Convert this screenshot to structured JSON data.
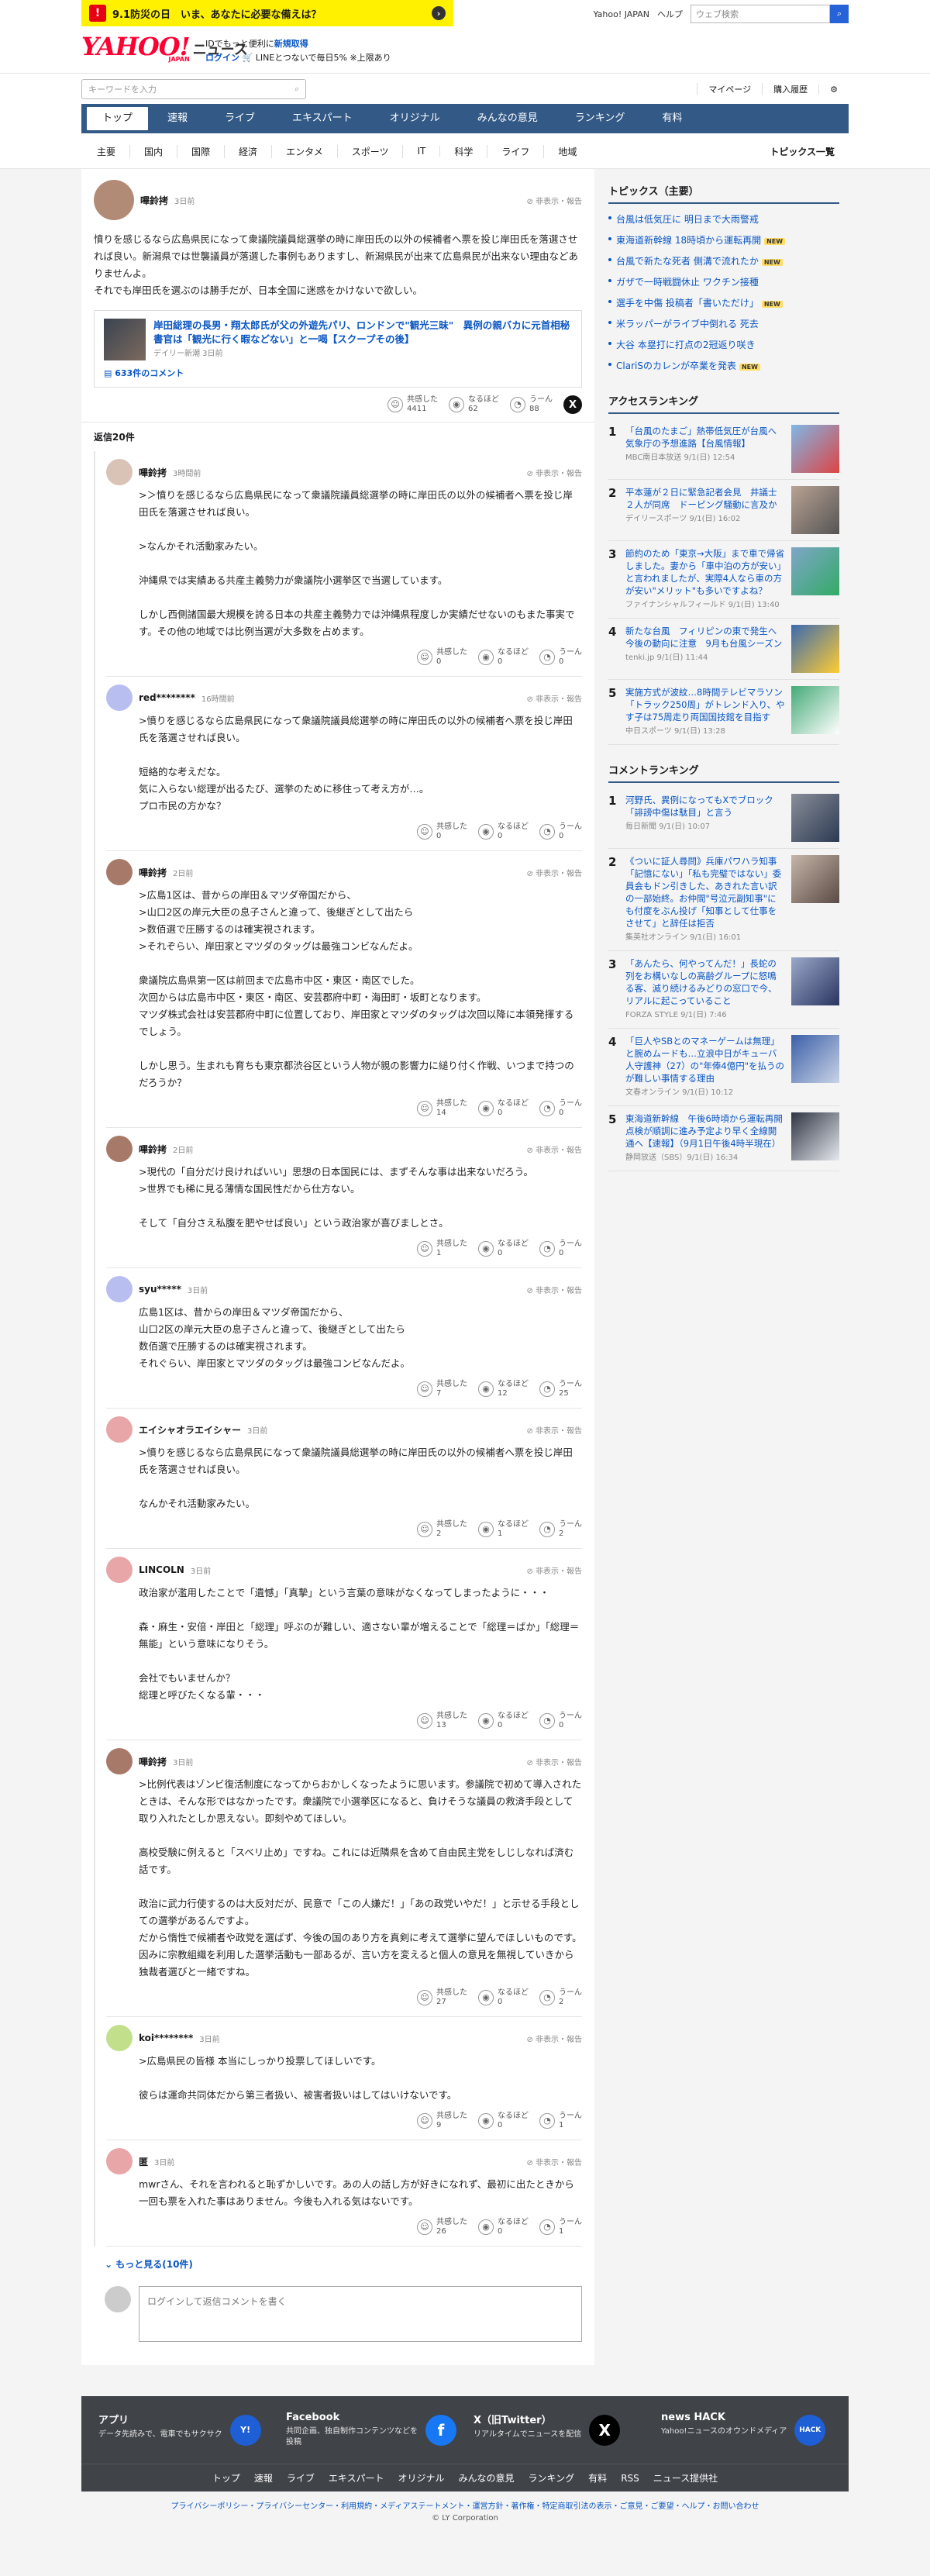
{
  "header": {
    "disaster": "9.1防災の日　いま、あなたに必要な備えは？",
    "yahoo_japan": "Yahoo! JAPAN",
    "help": "ヘルプ",
    "search_placeholder": "ウェブ検索",
    "logo": "YAHOO!",
    "logo_sub": "JAPAN",
    "news": "ニュース",
    "promo1_pre": "IDでもっと便利に",
    "promo1_link": "新規取得",
    "promo2_link": "ログイン",
    "promo2_rest": "🛒 LINEとつないで毎日5% ※上限あり"
  },
  "searchbar": {
    "placeholder": "キーワードを入力",
    "mypage": "マイページ",
    "purchase": "購入履歴"
  },
  "nav": [
    "トップ",
    "速報",
    "ライブ",
    "エキスパート",
    "オリジナル",
    "みんなの意見",
    "ランキング",
    "有料"
  ],
  "subnav": [
    "主要",
    "国内",
    "国際",
    "経済",
    "エンタメ",
    "スポーツ",
    "IT",
    "科学",
    "ライフ",
    "地域"
  ],
  "subnav_all": "トピックス一覧",
  "main_comment": {
    "name": "嗶鈴拷",
    "time": "3日前",
    "report": "非表示・報告",
    "body": "憤りを感じるなら広島県民になって衆議院議員総選挙の時に岸田氏の以外の候補者へ票を投じ岸田氏を落選させれば良い。新潟県では世襲議員が落選した事例もありますし、新潟県民が出来て広島県民が出来ない理由などありませんよ。\nそれでも岸田氏を選ぶのは勝手だが、日本全国に迷惑をかけないで欲しい。",
    "article_title": "岸田総理の長男・翔太郎氏が父の外遊先パリ、ロンドンで\"観光三昧\"　異例の親バカに元首相秘書官は「観光に行く暇などない」と一喝【スクープその後】",
    "article_src": "デイリー新潮 3日前",
    "comment_count": "633件のコメント",
    "r1_label": "共感した",
    "r1": "4411",
    "r2_label": "なるほど",
    "r2": "62",
    "r3_label": "うーん",
    "r3": "88"
  },
  "replies_header": "返信20件",
  "replies": [
    {
      "name": "嗶鈴拷",
      "time": "3時間前",
      "body": ">＞憤りを感じるなら広島県民になって衆議院議員総選挙の時に岸田氏の以外の候補者へ票を投じ岸田氏を落選させれば良い。\n\n>なんかそれ活動家みたい。\n\n沖縄県では実績ある共産主義勢力が衆議院小選挙区で当選しています。\n\nしかし西側諸国最大規模を誇る日本の共産主義勢力では沖縄県程度しか実績だせないのもまた事実です。その他の地域では比例当選が大多数を占めます。",
      "a": "0",
      "b": "0",
      "c": "0"
    },
    {
      "name": "red********",
      "time": "16時間前",
      "body": ">憤りを感じるなら広島県民になって衆議院議員総選挙の時に岸田氏の以外の候補者へ票を投じ岸田氏を落選させれば良い。\n\n短絡的な考えだな。\n気に入らない総理が出るたび、選挙のために移住って考え方が…。\nプロ市民の方かな？",
      "a": "0",
      "b": "0",
      "c": "0"
    },
    {
      "name": "嗶鈴拷",
      "time": "2日前",
      "body": ">広島1区は、昔からの岸田＆マツダ帝国だから、\n>山口2区の岸元大臣の息子さんと違って、後継ぎとして出たら\n>数佰選で圧勝するのは確実視されます。\n>それぞらい、岸田家とマツダのタッグは最強コンビなんだよ。\n\n衆議院広島県第一区は前回まで広島市中区・東区・南区でした。\n次回からは広島市中区・東区・南区、安芸郡府中町・海田町・坂町となります。\nマツダ株式会社は安芸郡府中町に位置しており、岸田家とマツダのタッグは次回以降に本領発揮するでしょう。\n\nしかし思う。生まれも育ちも東京都渋谷区という人物が親の影響力に縋り付く作戦、いつまで持つのだろうか？",
      "a": "14",
      "b": "0",
      "c": "0"
    },
    {
      "name": "嗶鈴拷",
      "time": "2日前",
      "body": ">現代の「自分だけ良ければいい」思想の日本国民には、まずそんな事は出来ないだろう。\n>世界でも稀に見る薄情な国民性だから仕方ない。\n\nそして「自分さえ私腹を肥やせば良い」という政治家が喜びましとさ。",
      "a": "1",
      "b": "0",
      "c": "0"
    },
    {
      "name": "syu*****",
      "time": "3日前",
      "body": "広島1区は、昔からの岸田＆マツダ帝国だから、\n山口2区の岸元大臣の息子さんと違って、後継ぎとして出たら\n数佰選で圧勝するのは確実視されます。\nそれぐらい、岸田家とマツダのタッグは最強コンビなんだよ。",
      "a": "7",
      "b": "12",
      "c": "25"
    },
    {
      "name": "エイシャオラエイシャー",
      "time": "3日前",
      "body": ">憤りを感じるなら広島県民になって衆議院議員総選挙の時に岸田氏の以外の候補者へ票を投じ岸田氏を落選させれば良い。\n\nなんかそれ活動家みたい。",
      "a": "2",
      "b": "1",
      "c": "2"
    },
    {
      "name": "LINCOLN",
      "time": "3日前",
      "body": "政治家が濫用したことで「遺憾」「真摯」という言葉の意味がなくなってしまったように・・・\n\n森・麻生・安倍・岸田と「総理」呼ぶのが難しい、適さない輩が増えることで「総理＝ばか」「総理＝無能」という意味になりそう。\n\n会社でもいませんか？\n総理と呼びたくなる輩・・・",
      "a": "13",
      "b": "0",
      "c": "0"
    },
    {
      "name": "嗶鈴拷",
      "time": "3日前",
      "body": ">比例代表はゾンビ復活制度になってからおかしくなったように思います。参議院で初めて導入されたときは、そんな形ではなかったです。衆議院で小選挙区になると、負けそうな議員の救済手段として取り入れたとしか思えない。即刻やめてほしい。\n\n高校受験に例えると「スベリ止め」ですね。これには近隣県を含めて自由民主党をしじしなれば済む話です。\n\n政治に武力行使するのは大反対だが、民意で「この人嫌だ！」「あの政党いやだ！」と示せる手段としての選挙があるんですよ。\nだから惰性で候補者や政党を選ばず、今後の国のあり方を真剣に考えて選挙に望んでほしいものです。\n因みに宗教組織を利用した選挙活動も一部あるが、言い方を変えると個人の意見を無視していきから独裁者選びと一緒ですね。",
      "a": "27",
      "b": "0",
      "c": "2"
    },
    {
      "name": "koi********",
      "time": "3日前",
      "body": ">広島県民の皆様 本当にしっかり投票してほしいです。\n\n彼らは運命共同体だから第三者扱い、被害者扱いはしてはいけないです。",
      "a": "9",
      "b": "0",
      "c": "1"
    },
    {
      "name": "匿",
      "time": "3日前",
      "body": "mwrさん、それを言われると恥ずかしいです。あの人の話し方が好きになれず、最初に出たときから一回も票を入れた事はありません。今後も入れる気はないです。",
      "a": "26",
      "b": "0",
      "c": "1"
    }
  ],
  "more": "もっと見る(10件)",
  "post_placeholder": "ログインして返信コメントを書く",
  "sidebar": {
    "topics_title": "トピックス（主要）",
    "topics": [
      {
        "t": "台風は低気圧に 明日まで大雨警戒",
        "n": false
      },
      {
        "t": "東海道新幹線 18時頃から運転再開",
        "n": true
      },
      {
        "t": "台風で新たな死者 側溝で流れたか",
        "n": true
      },
      {
        "t": "ガザで一時戦闘休止 ワクチン接種",
        "n": false
      },
      {
        "t": "選手を中傷 投稿者「書いただけ」",
        "n": true
      },
      {
        "t": "米ラッパーがライブ中倒れる 死去",
        "n": false
      },
      {
        "t": "大谷 本塁打に打点の2冠返り咲き",
        "n": false
      },
      {
        "t": "ClariSのカレンが卒業を発表",
        "n": true
      }
    ],
    "access_title": "アクセスランキング",
    "access": [
      {
        "t": "「台風のたまご」熱帯低気圧が台風へ　気象庁の予想進路【台風情報】",
        "s": "MBC南日本放送 9/1(日) 12:54"
      },
      {
        "t": "平本蓮が２日に緊急記者会見　井議士２人が同席　ドーピング騒動に言及か",
        "s": "デイリースポーツ 9/1(日) 16:02"
      },
      {
        "t": "節約のため「東京→大阪」まで車で帰省しました。妻から「車中泊の方が安い」と言われましたが、実際4人なら車の方が安い\"メリット\"も多いですよね？",
        "s": "ファイナンシャルフィールド 9/1(日) 13:40"
      },
      {
        "t": "新たな台風　フィリピンの東で発生へ　今後の動向に注意　9月も台風シーズン",
        "s": "tenki.jp 9/1(日) 11:44"
      },
      {
        "t": "実施方式が波紋…8時間テレビマラソン「トラック250周」がトレンド入り、やす子は75周走り両国国技館を目指す",
        "s": "中日スポーツ 9/1(日) 13:28"
      }
    ],
    "comment_title": "コメントランキング",
    "comments": [
      {
        "t": "河野氏、異例になってもXでブロック「誹謗中傷は駄目」と言う",
        "s": "毎日新聞 9/1(日) 10:07"
      },
      {
        "t": "《ついに証人尋問》兵庫パワハラ知事「記憶にない」「私も完璧ではない」委員会もドン引きした、あきれた言い訳の一部始終。お仲間\"号泣元副知事\"にも付度をぶん投げ「知事として仕事をさせて」と辞任は拒否",
        "s": "集英社オンライン 9/1(日) 16:01"
      },
      {
        "t": "「あんたら、何やってんだ！」長蛇の列をお構いなしの高齢グループに怒鳴る客、滅り続けるみどりの窓口で今、リアルに起こっていること",
        "s": "FORZA STYLE 9/1(日) 7:46"
      },
      {
        "t": "「巨人やSBとのマネーゲームは無理」と腕めムードも…立浪中日がキューバ人守護神（27）の\"年俸4億円\"を払うのが難しい事情する理由",
        "s": "文春オンライン 9/1(日) 10:12"
      },
      {
        "t": "東海道新幹線　午後6時頃から運転再開　点検が順調に進み予定より早く全線開通へ【速報】（9月1日午後4時半現在）",
        "s": "静岡放送（SBS）9/1(日) 16:34"
      }
    ]
  },
  "footer": {
    "apps": [
      {
        "h": "アプリ",
        "d": "データ先読みで、電車でもサクサク"
      },
      {
        "h": "Facebook",
        "d": "共同企画、独自制作コンテンツなどを投稿"
      },
      {
        "h": "X（旧Twitter）",
        "d": "リアルタイムでニュースを配信"
      },
      {
        "h": "news HACK",
        "d": "Yahoo!ニュースのオウンドメディア"
      }
    ],
    "nav": [
      "トップ",
      "速報",
      "ライブ",
      "エキスパート",
      "オリジナル",
      "みんなの意見",
      "ランキング",
      "有料",
      "RSS",
      "ニュース提供社"
    ],
    "legal": "プライバシーポリシー・プライバシーセンター・利用規約・メディアステートメント・運営方針・著作権・特定商取引法の表示・ご意見・ご要望・ヘルプ・お問い合わせ",
    "copyright": "© LY Corporation"
  }
}
